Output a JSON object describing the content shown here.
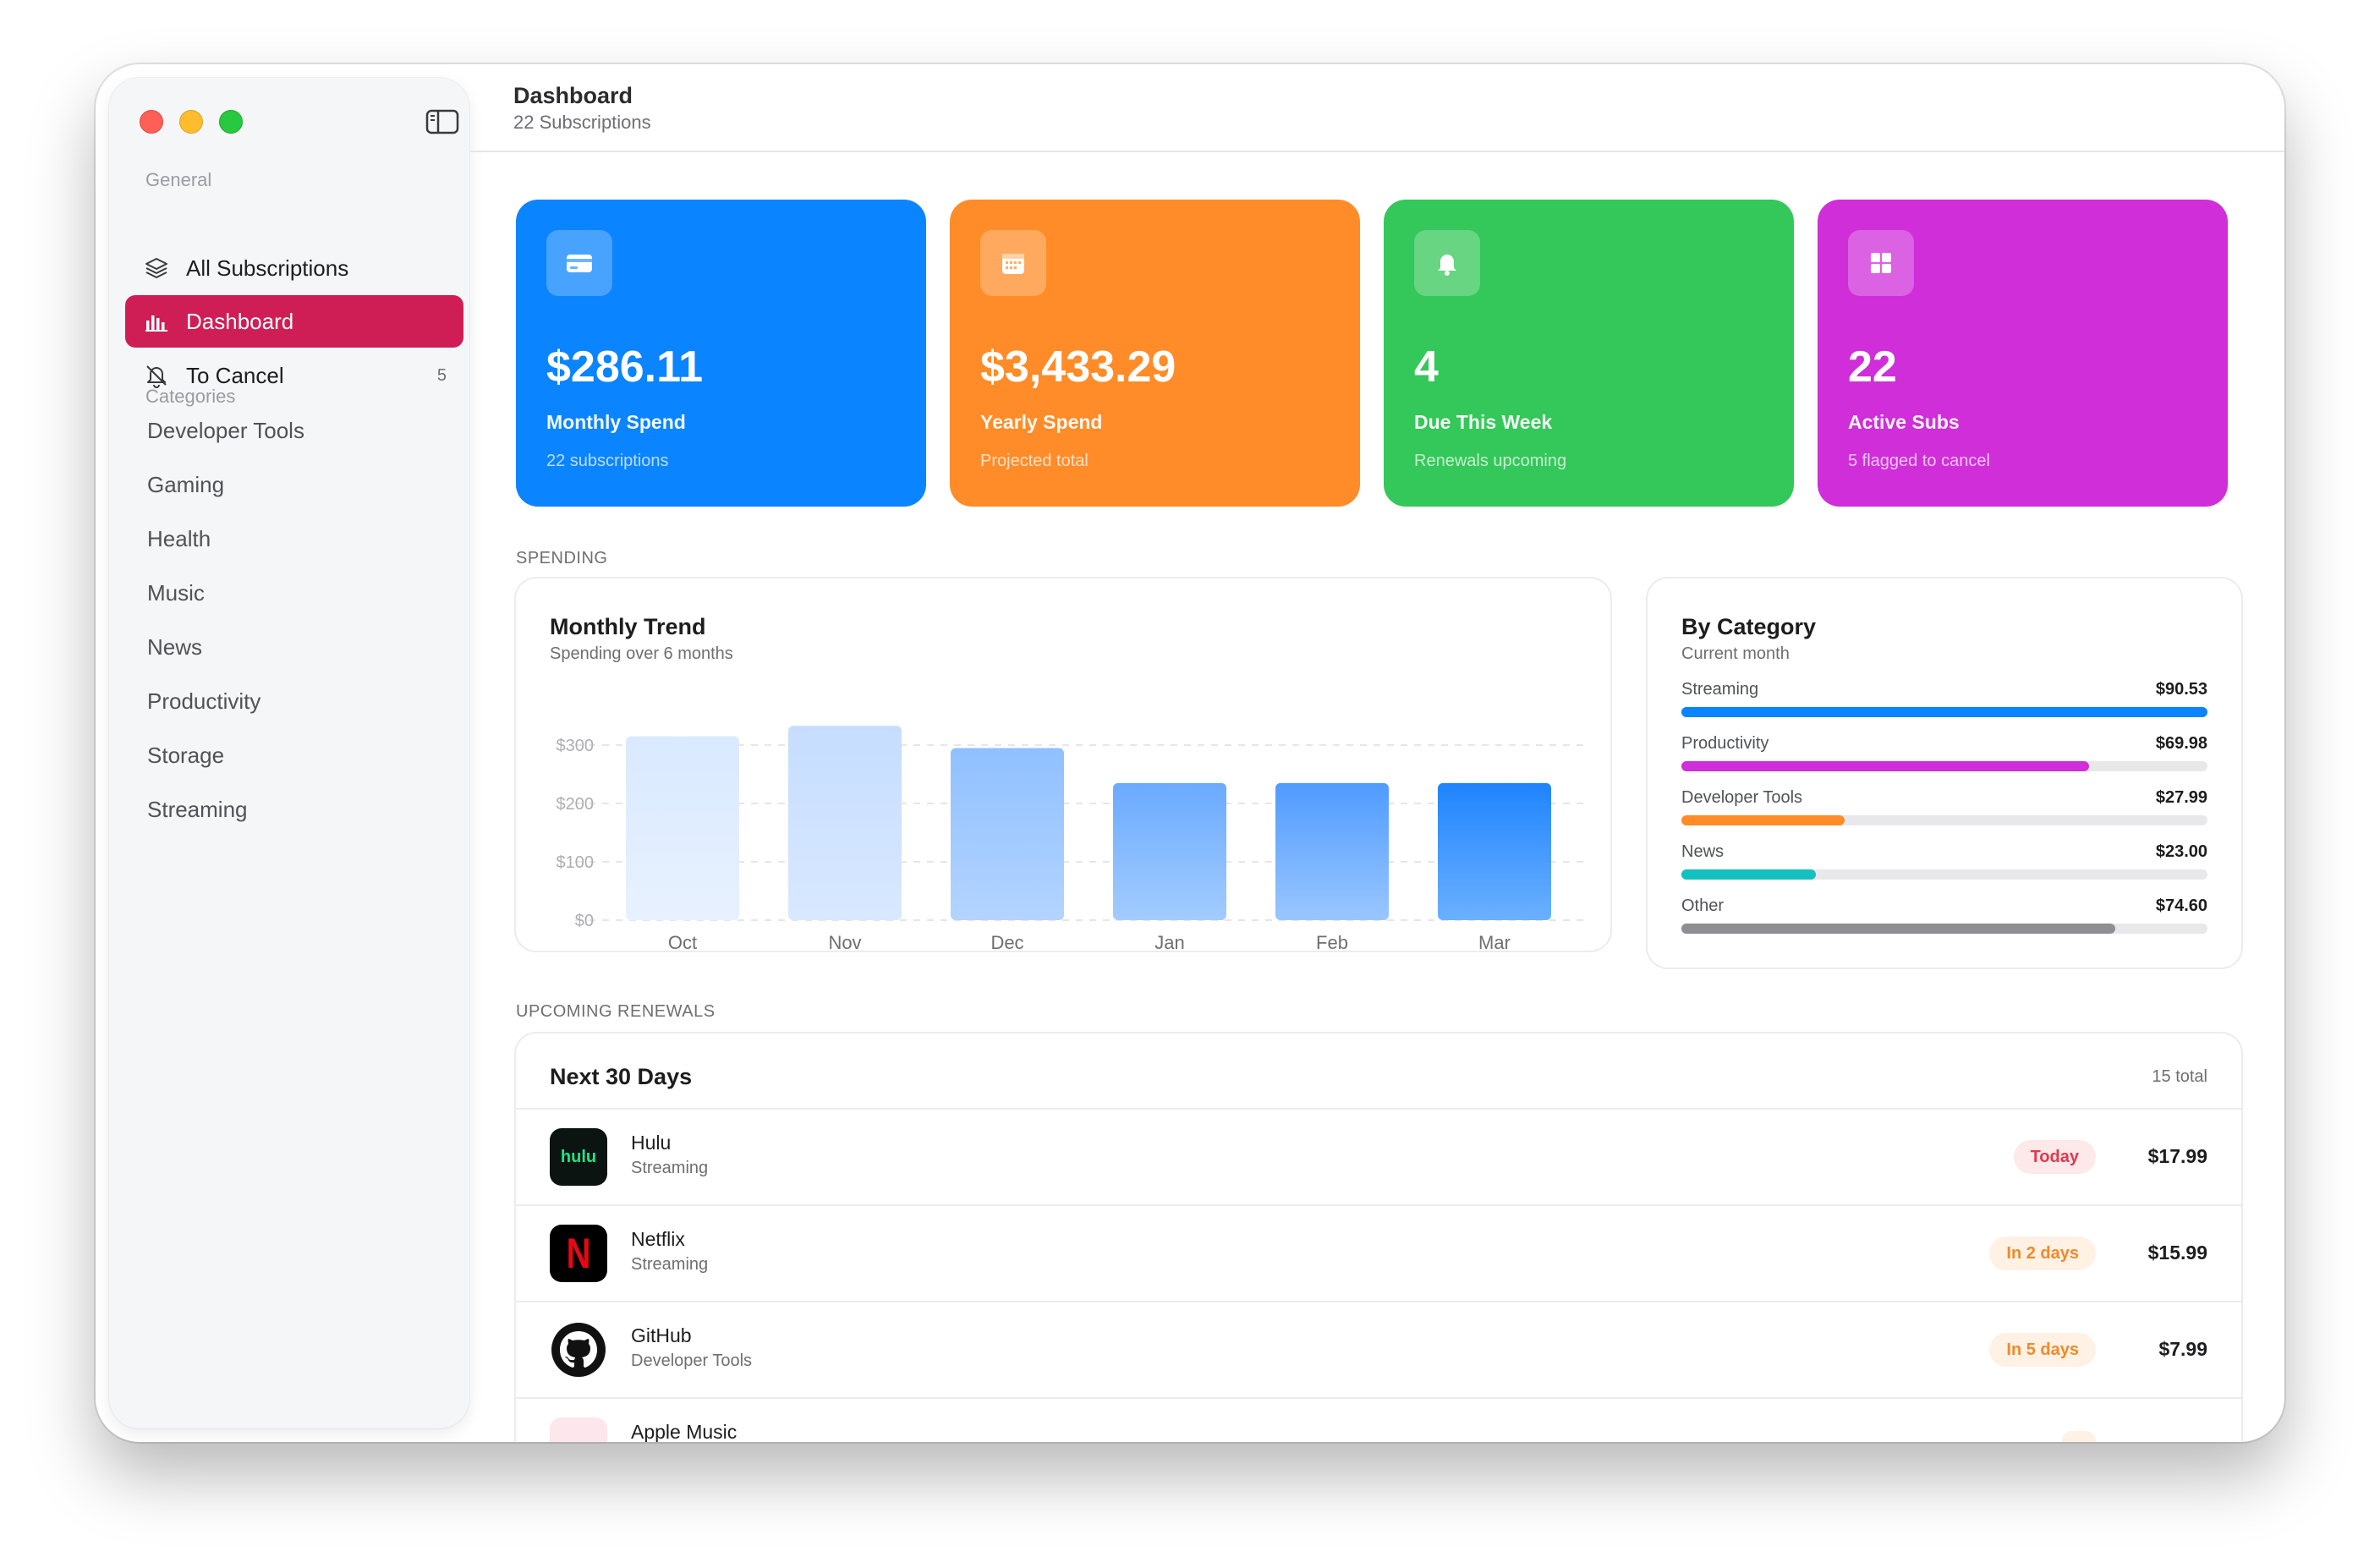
{
  "sidebar": {
    "general_label": "General",
    "nav": [
      {
        "label": "All Subscriptions",
        "icon": "layers-icon"
      },
      {
        "label": "Dashboard",
        "icon": "bar-chart-icon",
        "active": true
      },
      {
        "label": "To Cancel",
        "icon": "bell-icon",
        "count": "5"
      }
    ],
    "categories_label": "Categories",
    "categories": [
      "Developer Tools",
      "Gaming",
      "Health",
      "Music",
      "News",
      "Productivity",
      "Storage",
      "Streaming"
    ]
  },
  "header": {
    "title": "Dashboard",
    "subtitle": "22 Subscriptions"
  },
  "stats": [
    {
      "value": "$286.11",
      "label": "Monthly Spend",
      "sub": "22 subscriptions",
      "color": "#0a84ff",
      "icon": "credit-card-icon"
    },
    {
      "value": "$3,433.29",
      "label": "Yearly Spend",
      "sub": "Projected total",
      "color": "#ff8c28",
      "icon": "calendar-icon"
    },
    {
      "value": "4",
      "label": "Due This Week",
      "sub": "Renewals upcoming",
      "color": "#34c759",
      "icon": "bell-icon"
    },
    {
      "value": "22",
      "label": "Active Subs",
      "sub": "5 flagged to cancel",
      "color": "#cf2ed9",
      "icon": "grid-icon"
    }
  ],
  "spending_label": "SPENDING",
  "trend": {
    "title": "Monthly Trend",
    "subtitle": "Spending over 6 months"
  },
  "chart_data": {
    "type": "bar",
    "categories": [
      "Oct",
      "Nov",
      "Dec",
      "Jan",
      "Feb",
      "Mar"
    ],
    "values": [
      315,
      333,
      295,
      235,
      235,
      235
    ],
    "yticks": [
      "$300",
      "$200",
      "$100",
      "$0"
    ],
    "ylim": [
      0,
      300
    ],
    "xlabel": "",
    "ylabel": ""
  },
  "by_category": {
    "title": "By Category",
    "subtitle": "Current month",
    "items": [
      {
        "label": "Streaming",
        "value": "$90.53",
        "fraction": 1.0,
        "color": "#0a84ff"
      },
      {
        "label": "Productivity",
        "value": "$69.98",
        "fraction": 0.775,
        "color": "#cf2ed9"
      },
      {
        "label": "Developer Tools",
        "value": "$27.99",
        "fraction": 0.31,
        "color": "#ff8c28"
      },
      {
        "label": "News",
        "value": "$23.00",
        "fraction": 0.255,
        "color": "#14bfbf"
      },
      {
        "label": "Other",
        "value": "$74.60",
        "fraction": 0.825,
        "color": "#8e8e93"
      }
    ]
  },
  "renewals_label": "UPCOMING RENEWALS",
  "renewals": {
    "title": "Next 30 Days",
    "total": "15 total",
    "rows": [
      {
        "name": "Hulu",
        "category": "Streaming",
        "due": "Today",
        "price": "$17.99",
        "icon": "hulu-icon",
        "icon_text": "hulu"
      },
      {
        "name": "Netflix",
        "category": "Streaming",
        "due": "In 2 days",
        "price": "$15.99",
        "icon": "netflix-icon",
        "icon_text": "N"
      },
      {
        "name": "GitHub",
        "category": "Developer Tools",
        "due": "In 5 days",
        "price": "$7.99",
        "icon": "github-icon"
      },
      {
        "name": "Apple Music",
        "category": "",
        "due": "",
        "price": "",
        "icon": "apple-music-icon"
      }
    ]
  }
}
